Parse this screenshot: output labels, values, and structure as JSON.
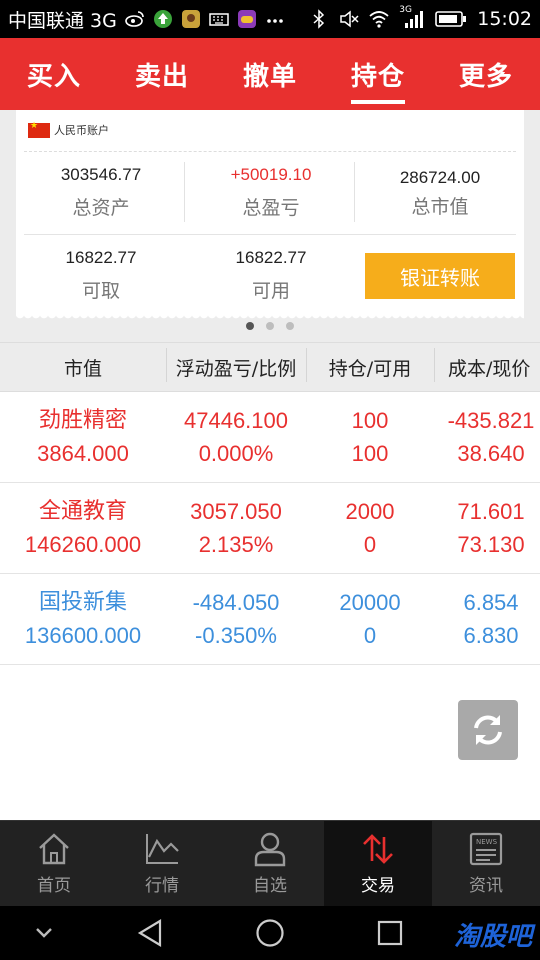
{
  "status_bar": {
    "carrier": "中国联通 3G",
    "network_badge": "3G",
    "time": "15:02",
    "icons": [
      "weibo-icon",
      "upload-icon",
      "app-icon",
      "keyboard-icon",
      "game-icon",
      "more-icon",
      "bluetooth-icon",
      "mute-icon",
      "wifi-icon",
      "signal-icon",
      "battery-icon"
    ]
  },
  "top_tabs": [
    {
      "label": "买入",
      "active": false
    },
    {
      "label": "卖出",
      "active": false
    },
    {
      "label": "撤单",
      "active": false
    },
    {
      "label": "持仓",
      "active": true
    },
    {
      "label": "更多",
      "active": false
    }
  ],
  "account": {
    "name": "人民币账户",
    "total_assets": {
      "value": "303546.77",
      "label": "总资产"
    },
    "total_pnl": {
      "value": "+50019.10",
      "label": "总盈亏"
    },
    "market_value": {
      "value": "286724.00",
      "label": "总市值"
    },
    "withdrawable": {
      "value": "16822.77",
      "label": "可取"
    },
    "available": {
      "value": "16822.77",
      "label": "可用"
    },
    "transfer_button": "银证转账"
  },
  "pager": {
    "count": 3,
    "active": 0
  },
  "table": {
    "headers": [
      "市值",
      "浮动盈亏/比例",
      "持仓/可用",
      "成本/现价"
    ],
    "rows": [
      {
        "name": "劲胜精密",
        "market_value": "3864.000",
        "pnl": "47446.100",
        "pnl_ratio": "0.000%",
        "position": "100",
        "available": "100",
        "cost": "-435.821",
        "price": "38.640",
        "trend": "up"
      },
      {
        "name": "全通教育",
        "market_value": "146260.000",
        "pnl": "3057.050",
        "pnl_ratio": "2.135%",
        "position": "2000",
        "available": "0",
        "cost": "71.601",
        "price": "73.130",
        "trend": "up"
      },
      {
        "name": "国投新集",
        "market_value": "136600.000",
        "pnl": "-484.050",
        "pnl_ratio": "-0.350%",
        "position": "20000",
        "available": "0",
        "cost": "6.854",
        "price": "6.830",
        "trend": "down"
      }
    ]
  },
  "refresh_icon": "refresh-icon",
  "bottom_nav": [
    {
      "label": "首页",
      "icon": "home-icon",
      "active": false
    },
    {
      "label": "行情",
      "icon": "chart-icon",
      "active": false
    },
    {
      "label": "自选",
      "icon": "person-icon",
      "active": false
    },
    {
      "label": "交易",
      "icon": "trade-icon",
      "active": true
    },
    {
      "label": "资讯",
      "icon": "news-icon",
      "active": false
    }
  ],
  "news_icon_text": "NEWS",
  "system_nav": [
    "collapse-icon",
    "back-icon",
    "home-circle-icon",
    "recents-icon"
  ],
  "watermark": "淘股吧",
  "colors": {
    "brand_red": "#e8302f",
    "gain_red": "#e8302f",
    "loss_blue": "#3d8fdc",
    "button_orange": "#f6ad1b"
  }
}
